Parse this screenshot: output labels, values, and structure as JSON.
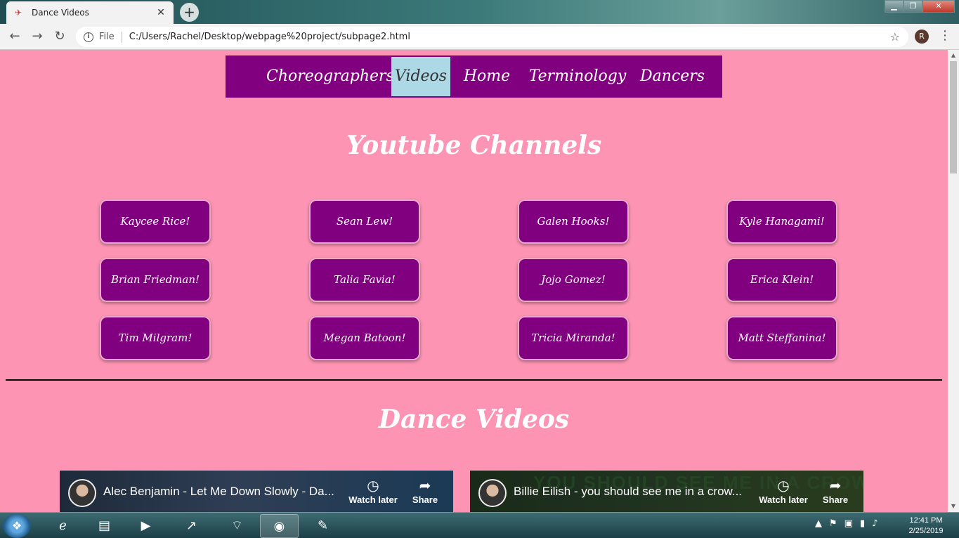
{
  "browser": {
    "tab_title": "Dance Videos",
    "file_label": "File",
    "url": "C:/Users/Rachel/Desktop/webpage%20project/subpage2.html",
    "avatar_letter": "R",
    "icons": [
      "back-icon",
      "forward-icon",
      "reload-icon",
      "info-icon",
      "star-icon",
      "menu-icon"
    ]
  },
  "nav": {
    "items": [
      {
        "label": "Choreographers",
        "active": false
      },
      {
        "label": "Videos",
        "active": true
      },
      {
        "label": "Home",
        "active": false
      },
      {
        "label": "Terminology",
        "active": false
      },
      {
        "label": "Dancers",
        "active": false
      }
    ],
    "bg_color": "#800080",
    "active_color": "#add8e6"
  },
  "page": {
    "bg_color": "#fd94b4",
    "youtube_heading": "Youtube Channels",
    "videos_heading": "Dance Videos"
  },
  "channels": [
    [
      "Kaycee Rice!",
      "Sean Lew!",
      "Galen Hooks!",
      "Kyle Hanagami!"
    ],
    [
      "Brian Friedman!",
      "Talia Favia!",
      "Jojo Gomez!",
      "Erica Klein!"
    ],
    [
      "Tim Milgram!",
      "Megan Batoon!",
      "Tricia Miranda!",
      "Matt Steffanina!"
    ]
  ],
  "videos": [
    {
      "title": "Alec Benjamin - Let Me Down Slowly - Da...",
      "watch_later": "Watch later",
      "share": "Share"
    },
    {
      "title": "Billie Eilish - you should see me in a crow...",
      "watch_later": "Watch later",
      "share": "Share",
      "banner": "YOU SHOULD SEE ME IN A CROWN"
    }
  ],
  "taskbar": {
    "time": "12:41 PM",
    "date": "2/25/2019"
  }
}
